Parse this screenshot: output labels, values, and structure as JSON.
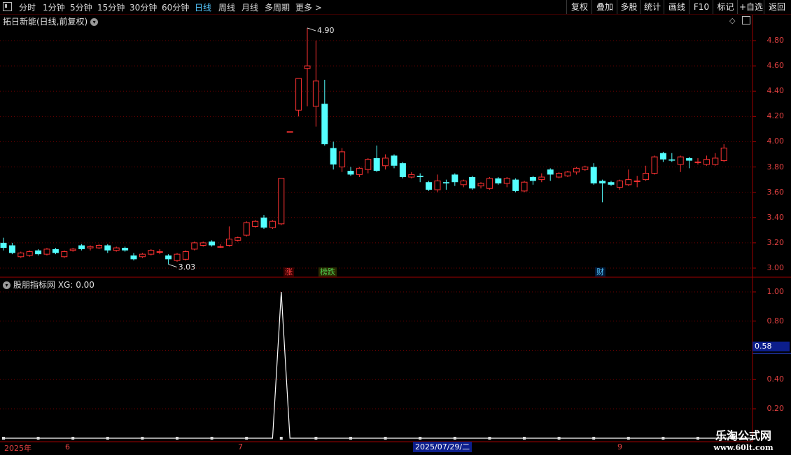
{
  "toolbar": {
    "periods": [
      "分时",
      "1分钟",
      "5分钟",
      "15分钟",
      "30分钟",
      "60分钟",
      "日线",
      "周线",
      "月线",
      "多周期",
      "更多 >"
    ],
    "active_period": "日线",
    "right_buttons": [
      "复权",
      "叠加",
      "多股",
      "统计",
      "画线",
      "F10",
      "标记",
      "+自选",
      "返回"
    ]
  },
  "chart_title": "拓日新能(日线,前复权)",
  "chart_title_icon": "chevron-down-icon",
  "price_axis": [
    "4.80",
    "4.60",
    "4.40",
    "4.20",
    "4.00",
    "3.80",
    "3.60",
    "3.40",
    "3.20",
    "3.00"
  ],
  "max_label": "4.90",
  "min_label": "3.03",
  "event_badges": [
    {
      "text": "涨",
      "color": "#ff4040"
    },
    {
      "text": "榜跌",
      "color": "#40c040"
    },
    {
      "text": "财",
      "color": "#55c8ff"
    }
  ],
  "indicator": {
    "title": "股朋指标网 XG: 0.00",
    "axis": [
      "1.00",
      "0.80",
      "0.40",
      "0.20"
    ],
    "highlight_value": "0.58"
  },
  "dates": {
    "year": "2025年",
    "m6": "6",
    "m7": "7",
    "highlight": "2025/07/29/二",
    "m9": "9"
  },
  "watermark": {
    "line1": "乐淘公式网",
    "line2": "www.60lt.com"
  },
  "colors": {
    "up": "#ff3232",
    "down": "#54ffff",
    "grid": "#700000",
    "axis_text": "#e04040",
    "line": "#ffffff"
  },
  "chart_data": {
    "type": "candlestick",
    "ylim": [
      2.95,
      5.0
    ],
    "candles": [
      {
        "o": 3.2,
        "c": 3.16,
        "h": 3.24,
        "l": 3.14
      },
      {
        "o": 3.18,
        "c": 3.12,
        "h": 3.2,
        "l": 3.11
      },
      {
        "o": 3.09,
        "c": 3.12,
        "h": 3.13,
        "l": 3.08
      },
      {
        "o": 3.1,
        "c": 3.13,
        "h": 3.14,
        "l": 3.09
      },
      {
        "o": 3.14,
        "c": 3.11,
        "h": 3.15,
        "l": 3.1
      },
      {
        "o": 3.11,
        "c": 3.15,
        "h": 3.16,
        "l": 3.1
      },
      {
        "o": 3.15,
        "c": 3.12,
        "h": 3.16,
        "l": 3.11
      },
      {
        "o": 3.09,
        "c": 3.13,
        "h": 3.14,
        "l": 3.08
      },
      {
        "o": 3.14,
        "c": 3.15,
        "h": 3.16,
        "l": 3.13
      },
      {
        "o": 3.18,
        "c": 3.15,
        "h": 3.19,
        "l": 3.14
      },
      {
        "o": 3.16,
        "c": 3.17,
        "h": 3.18,
        "l": 3.14
      },
      {
        "o": 3.16,
        "c": 3.18,
        "h": 3.19,
        "l": 3.15
      },
      {
        "o": 3.18,
        "c": 3.14,
        "h": 3.19,
        "l": 3.12
      },
      {
        "o": 3.14,
        "c": 3.16,
        "h": 3.17,
        "l": 3.13
      },
      {
        "o": 3.16,
        "c": 3.14,
        "h": 3.17,
        "l": 3.13
      },
      {
        "o": 3.1,
        "c": 3.07,
        "h": 3.12,
        "l": 3.06
      },
      {
        "o": 3.09,
        "c": 3.11,
        "h": 3.12,
        "l": 3.08
      },
      {
        "o": 3.11,
        "c": 3.14,
        "h": 3.15,
        "l": 3.1
      },
      {
        "o": 3.13,
        "c": 3.13,
        "h": 3.15,
        "l": 3.11
      },
      {
        "o": 3.1,
        "c": 3.07,
        "h": 3.11,
        "l": 3.03
      },
      {
        "o": 3.06,
        "c": 3.11,
        "h": 3.12,
        "l": 3.05
      },
      {
        "o": 3.07,
        "c": 3.13,
        "h": 3.14,
        "l": 3.06
      },
      {
        "o": 3.15,
        "c": 3.2,
        "h": 3.21,
        "l": 3.14
      },
      {
        "o": 3.18,
        "c": 3.2,
        "h": 3.21,
        "l": 3.17
      },
      {
        "o": 3.21,
        "c": 3.18,
        "h": 3.22,
        "l": 3.17
      },
      {
        "o": 3.17,
        "c": 3.17,
        "h": 3.19,
        "l": 3.16
      },
      {
        "o": 3.18,
        "c": 3.23,
        "h": 3.33,
        "l": 3.17
      },
      {
        "o": 3.22,
        "c": 3.24,
        "h": 3.25,
        "l": 3.21
      },
      {
        "o": 3.26,
        "c": 3.36,
        "h": 3.37,
        "l": 3.25
      },
      {
        "o": 3.33,
        "c": 3.37,
        "h": 3.38,
        "l": 3.32
      },
      {
        "o": 3.4,
        "c": 3.32,
        "h": 3.42,
        "l": 3.31
      },
      {
        "o": 3.32,
        "c": 3.37,
        "h": 3.38,
        "l": 3.31
      },
      {
        "o": 3.35,
        "c": 3.71,
        "h": 3.71,
        "l": 3.34
      },
      {
        "o": 4.08,
        "c": 4.08,
        "h": 4.08,
        "l": 4.08
      },
      {
        "o": 4.25,
        "c": 4.5,
        "h": 4.5,
        "l": 4.2
      },
      {
        "o": 4.58,
        "c": 4.6,
        "h": 4.9,
        "l": 4.28
      },
      {
        "o": 4.28,
        "c": 4.48,
        "h": 4.8,
        "l": 4.12
      },
      {
        "o": 4.3,
        "c": 3.98,
        "h": 4.49,
        "l": 3.97
      },
      {
        "o": 3.95,
        "c": 3.82,
        "h": 4.0,
        "l": 3.78
      },
      {
        "o": 3.8,
        "c": 3.92,
        "h": 3.95,
        "l": 3.76
      },
      {
        "o": 3.77,
        "c": 3.74,
        "h": 3.8,
        "l": 3.73
      },
      {
        "o": 3.74,
        "c": 3.79,
        "h": 3.8,
        "l": 3.72
      },
      {
        "o": 3.78,
        "c": 3.86,
        "h": 3.87,
        "l": 3.75
      },
      {
        "o": 3.87,
        "c": 3.77,
        "h": 3.97,
        "l": 3.76
      },
      {
        "o": 3.81,
        "c": 3.87,
        "h": 3.9,
        "l": 3.78
      },
      {
        "o": 3.89,
        "c": 3.81,
        "h": 3.9,
        "l": 3.79
      },
      {
        "o": 3.83,
        "c": 3.72,
        "h": 3.84,
        "l": 3.71
      },
      {
        "o": 3.72,
        "c": 3.74,
        "h": 3.76,
        "l": 3.71
      },
      {
        "o": 3.73,
        "c": 3.72,
        "h": 3.75,
        "l": 3.68
      },
      {
        "o": 3.68,
        "c": 3.62,
        "h": 3.69,
        "l": 3.61
      },
      {
        "o": 3.62,
        "c": 3.69,
        "h": 3.74,
        "l": 3.6
      },
      {
        "o": 3.68,
        "c": 3.67,
        "h": 3.7,
        "l": 3.62
      },
      {
        "o": 3.74,
        "c": 3.68,
        "h": 3.75,
        "l": 3.65
      },
      {
        "o": 3.66,
        "c": 3.69,
        "h": 3.7,
        "l": 3.64
      },
      {
        "o": 3.72,
        "c": 3.63,
        "h": 3.73,
        "l": 3.62
      },
      {
        "o": 3.65,
        "c": 3.67,
        "h": 3.68,
        "l": 3.63
      },
      {
        "o": 3.63,
        "c": 3.71,
        "h": 3.72,
        "l": 3.62
      },
      {
        "o": 3.71,
        "c": 3.67,
        "h": 3.72,
        "l": 3.66
      },
      {
        "o": 3.67,
        "c": 3.71,
        "h": 3.72,
        "l": 3.64
      },
      {
        "o": 3.7,
        "c": 3.61,
        "h": 3.71,
        "l": 3.6
      },
      {
        "o": 3.61,
        "c": 3.68,
        "h": 3.69,
        "l": 3.6
      },
      {
        "o": 3.72,
        "c": 3.69,
        "h": 3.73,
        "l": 3.66
      },
      {
        "o": 3.7,
        "c": 3.72,
        "h": 3.75,
        "l": 3.68
      },
      {
        "o": 3.78,
        "c": 3.74,
        "h": 3.79,
        "l": 3.69
      },
      {
        "o": 3.72,
        "c": 3.75,
        "h": 3.76,
        "l": 3.71
      },
      {
        "o": 3.73,
        "c": 3.76,
        "h": 3.77,
        "l": 3.72
      },
      {
        "o": 3.76,
        "c": 3.79,
        "h": 3.8,
        "l": 3.74
      },
      {
        "o": 3.78,
        "c": 3.8,
        "h": 3.81,
        "l": 3.77
      },
      {
        "o": 3.8,
        "c": 3.67,
        "h": 3.83,
        "l": 3.66
      },
      {
        "o": 3.69,
        "c": 3.67,
        "h": 3.7,
        "l": 3.52
      },
      {
        "o": 3.68,
        "c": 3.66,
        "h": 3.69,
        "l": 3.65
      },
      {
        "o": 3.64,
        "c": 3.69,
        "h": 3.7,
        "l": 3.62
      },
      {
        "o": 3.66,
        "c": 3.7,
        "h": 3.78,
        "l": 3.65
      },
      {
        "o": 3.69,
        "c": 3.69,
        "h": 3.73,
        "l": 3.64
      },
      {
        "o": 3.7,
        "c": 3.75,
        "h": 3.81,
        "l": 3.69
      },
      {
        "o": 3.75,
        "c": 3.88,
        "h": 3.89,
        "l": 3.74
      },
      {
        "o": 3.91,
        "c": 3.86,
        "h": 3.92,
        "l": 3.84
      },
      {
        "o": 3.86,
        "c": 3.85,
        "h": 3.91,
        "l": 3.84
      },
      {
        "o": 3.82,
        "c": 3.88,
        "h": 3.89,
        "l": 3.76
      },
      {
        "o": 3.87,
        "c": 3.85,
        "h": 3.88,
        "l": 3.79
      },
      {
        "o": 3.84,
        "c": 3.84,
        "h": 3.87,
        "l": 3.82
      },
      {
        "o": 3.82,
        "c": 3.86,
        "h": 3.89,
        "l": 3.81
      },
      {
        "o": 3.82,
        "c": 3.87,
        "h": 3.91,
        "l": 3.81
      },
      {
        "o": 3.85,
        "c": 3.95,
        "h": 3.98,
        "l": 3.84
      }
    ],
    "indicator_values": [
      0,
      0,
      0,
      0,
      0,
      0,
      0,
      0,
      0,
      0,
      0,
      0,
      0,
      0,
      0,
      0,
      0,
      0,
      0,
      0,
      0,
      0,
      0,
      0,
      0,
      0,
      0,
      0,
      0,
      0,
      0,
      0,
      1,
      0,
      0,
      0,
      0,
      0,
      0,
      0,
      0,
      0,
      0,
      0,
      0,
      0,
      0,
      0,
      0,
      0,
      0,
      0,
      0,
      0,
      0,
      0,
      0,
      0,
      0,
      0,
      0,
      0,
      0,
      0,
      0,
      0,
      0,
      0,
      0,
      0,
      0,
      0,
      0,
      0,
      0,
      0,
      0,
      0,
      0,
      0,
      0,
      0,
      0,
      0,
      0
    ]
  }
}
